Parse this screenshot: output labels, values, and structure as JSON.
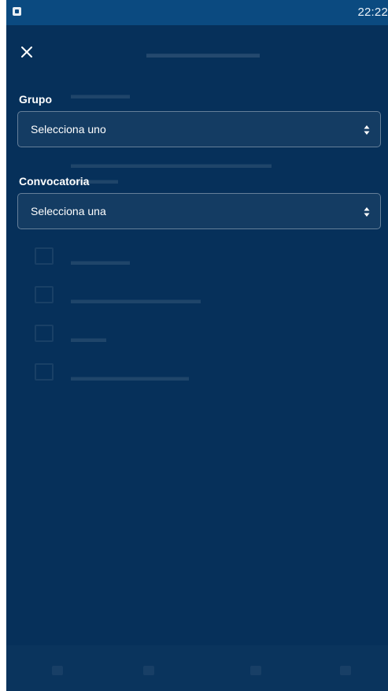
{
  "status_bar": {
    "time": "22:22",
    "app_icon": "app-badge-icon"
  },
  "form": {
    "close_icon": "close-icon",
    "group": {
      "label": "Grupo",
      "value": "Selecciona uno"
    },
    "call": {
      "label": "Convocatoria",
      "value": "Selecciona una"
    },
    "select_icon": "updown-arrows-icon"
  }
}
